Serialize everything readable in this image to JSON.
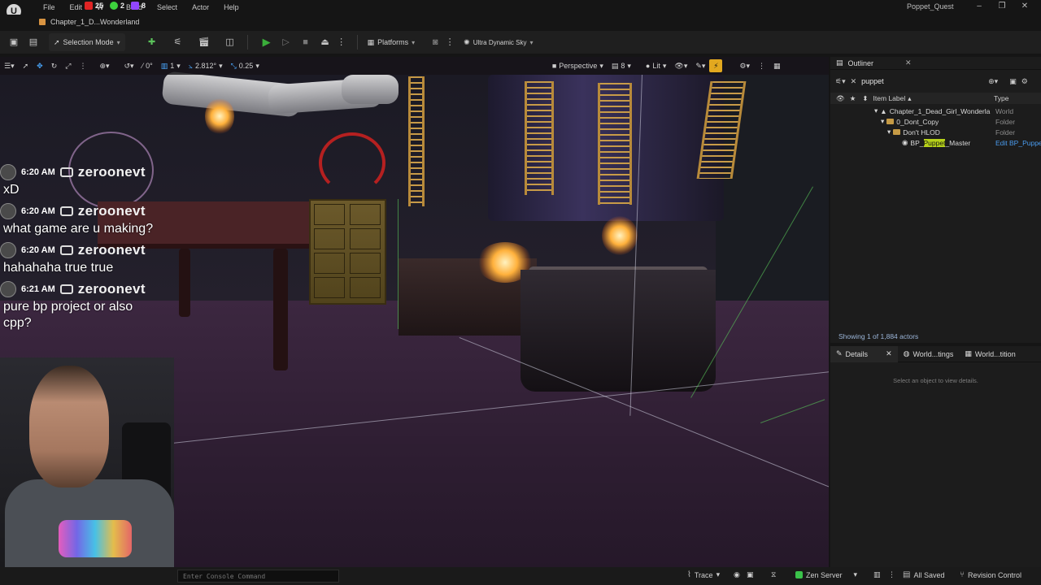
{
  "app": {
    "project_name": "Poppet_Quest",
    "level_tab": "Chapter_1_D...Wonderland",
    "logo": "U"
  },
  "menu": {
    "items": [
      "File",
      "Edit",
      "W",
      "Build",
      "Select",
      "Actor",
      "Help"
    ]
  },
  "stream_counters": [
    {
      "icon": "youtube-icon",
      "value": "25",
      "color": "#e02424"
    },
    {
      "icon": "kick-icon",
      "value": "2",
      "color": "#3dd13d"
    },
    {
      "icon": "twitch-icon",
      "value": "8",
      "color": "#9146ff"
    }
  ],
  "toolbar": {
    "selection_mode": "Selection Mode",
    "platforms": "Platforms",
    "sky": "Ultra Dynamic Sky"
  },
  "viewport_toolbar": {
    "rotation_snap": "0°",
    "grid_snap": "1",
    "angle": "2.812°",
    "scale": "0.25",
    "perspective": "Perspective",
    "camera_speed": "8",
    "lit": "Lit"
  },
  "chat": [
    {
      "time": "6:20 AM",
      "user": "zeroonevt",
      "text": "xD"
    },
    {
      "time": "6:20 AM",
      "user": "zeroonevt",
      "text": "what game are u making?"
    },
    {
      "time": "6:20 AM",
      "user": "zeroonevt",
      "text": "hahahaha true true"
    },
    {
      "time": "6:21 AM",
      "user": "zeroonevt",
      "text": "pure bp project or also cpp?"
    }
  ],
  "outliner": {
    "title": "Outliner",
    "search_value": "puppet",
    "col_label": "Item Label",
    "col_type": "Type",
    "rows": [
      {
        "label": "Chapter_1_Dead_Girl_Wonderla",
        "type": "World"
      },
      {
        "label": "0_Dont_Copy",
        "type": "Folder"
      },
      {
        "label": "Don't HLOD",
        "type": "Folder"
      },
      {
        "label_pre": "BP_",
        "label_hl": "Puppet",
        "label_post": "_Master",
        "type": "Edit BP_Puppe"
      }
    ],
    "footer": "Showing 1 of 1,884 actors"
  },
  "details": {
    "tabs": [
      "Details",
      "World...tings",
      "World...tition"
    ],
    "empty_message": "Select an object to view details."
  },
  "statusbar": {
    "console_placeholder": "Enter Console Command",
    "trace": "Trace",
    "zen_server": "Zen Server",
    "all_saved": "All Saved",
    "revision_control": "Revision Control"
  }
}
